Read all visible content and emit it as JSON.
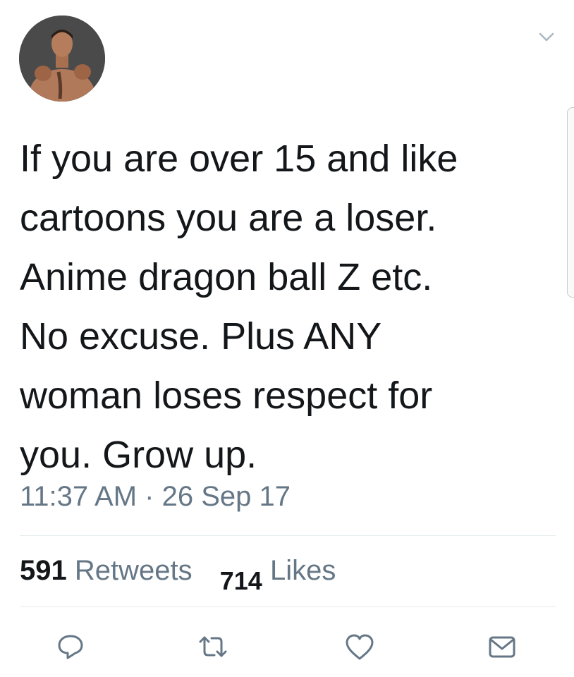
{
  "tweet": {
    "lines": [
      "If you are over 15 and like",
      "cartoons you are a loser.",
      "Anime dragon ball Z etc.",
      "No excuse. Plus ANY",
      "woman loses respect for",
      "you. Grow up."
    ],
    "time": "11:37 AM",
    "date_separator": "·",
    "date": "26 Sep 17"
  },
  "stats": {
    "retweets_count": "591",
    "retweets_label": "Retweets",
    "likes_count": "714",
    "likes_label": "Likes"
  },
  "icons": {
    "menu": "chevron-down-icon",
    "reply": "reply-icon",
    "retweet": "retweet-icon",
    "like": "heart-icon",
    "message": "envelope-icon"
  },
  "colors": {
    "text": "#14171a",
    "secondary": "#657786",
    "divider": "#e6ecf0"
  }
}
